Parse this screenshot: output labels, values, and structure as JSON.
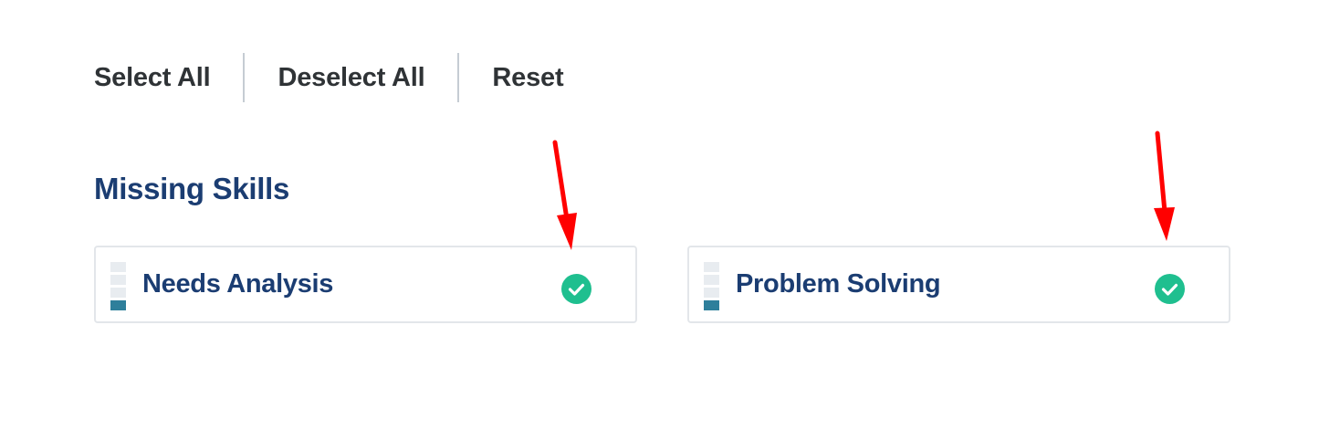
{
  "toolbar": {
    "select_all": "Select All",
    "deselect_all": "Deselect All",
    "reset": "Reset"
  },
  "section": {
    "title": "Missing Skills",
    "skills": [
      {
        "label": "Needs Analysis",
        "level": 1,
        "level_max": 4,
        "selected": true
      },
      {
        "label": "Problem Solving",
        "level": 1,
        "level_max": 4,
        "selected": true
      }
    ]
  },
  "colors": {
    "title": "#1b3d72",
    "toolbar_text": "#2f3336",
    "check": "#1fbf8f",
    "level_on": "#2e7f9b",
    "level_off": "#e8ecf0",
    "annotation_arrow": "#ff0000"
  },
  "icons": {
    "selected": "check-circle-icon",
    "level": "skill-level-bars-icon",
    "annotation": "red-arrow-icon"
  }
}
